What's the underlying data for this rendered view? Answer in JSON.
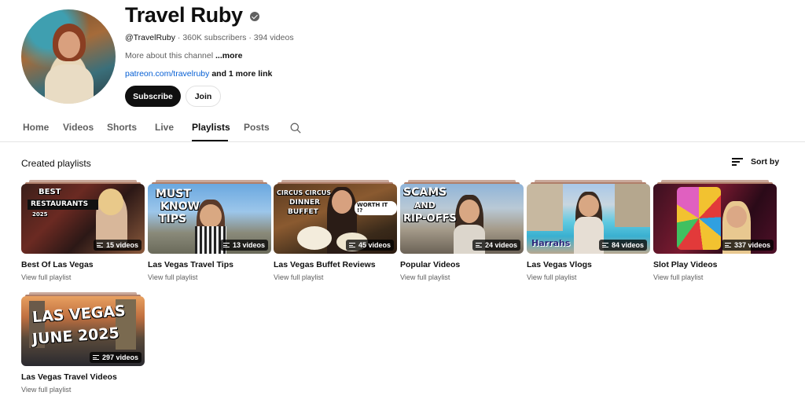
{
  "channel": {
    "name": "Travel Ruby",
    "handle": "@TravelRuby",
    "subscribers": "360K subscribers",
    "videos": "394 videos",
    "about": "More about this channel",
    "about_more": "...more",
    "link": "patreon.com/travelruby",
    "link_extra": "and 1 more link",
    "subscribe_label": "Subscribe",
    "join_label": "Join"
  },
  "tabs": [
    {
      "label": "Home"
    },
    {
      "label": "Videos"
    },
    {
      "label": "Shorts"
    },
    {
      "label": "Live"
    },
    {
      "label": "Playlists",
      "active": true
    },
    {
      "label": "Posts"
    }
  ],
  "section": {
    "title": "Created playlists",
    "sort_label": "Sort by"
  },
  "playlists": [
    {
      "title": "Best Of Las Vegas",
      "count": "15 videos",
      "sub": "View full playlist",
      "overlay": [
        "BEST",
        "RESTAURANTS",
        "2025"
      ]
    },
    {
      "title": "Las Vegas Travel Tips",
      "count": "13 videos",
      "sub": "View full playlist",
      "overlay": [
        "MUST",
        "KNOW",
        "TIPS"
      ]
    },
    {
      "title": "Las Vegas Buffet Reviews",
      "count": "45 videos",
      "sub": "View full playlist",
      "overlay": [
        "CIRCUS CIRCUS",
        "DINNER",
        "BUFFET",
        "WORTH IT !?"
      ]
    },
    {
      "title": "Popular Videos",
      "count": "24 videos",
      "sub": "View full playlist",
      "overlay": [
        "SCAMS",
        "AND",
        "RIP-OFFS"
      ]
    },
    {
      "title": "Las Vegas Vlogs",
      "count": "84 videos",
      "sub": "View full playlist",
      "overlay": [
        "Harrahs"
      ]
    },
    {
      "title": "Slot Play Videos",
      "count": "337 videos",
      "sub": "View full playlist",
      "overlay": []
    },
    {
      "title": "Las Vegas Travel Videos",
      "count": "297 videos",
      "sub": "View full playlist",
      "overlay": [
        "LAS VEGAS",
        "JUNE 2025"
      ]
    }
  ]
}
